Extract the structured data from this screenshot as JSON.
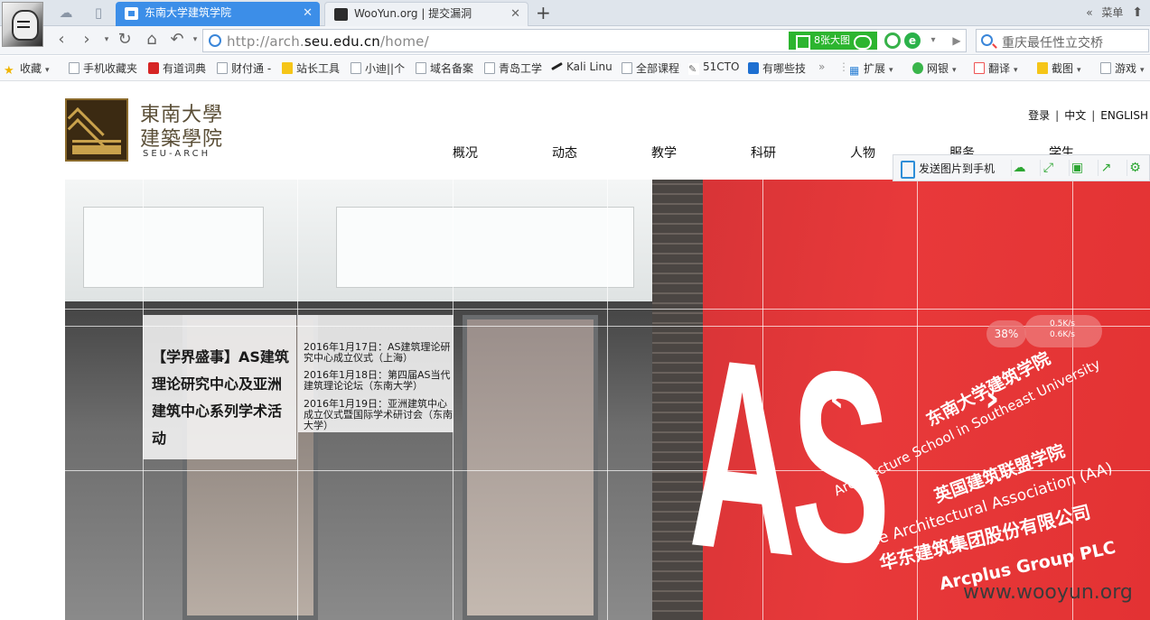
{
  "browser": {
    "tabs": [
      {
        "label": "东南大学建筑学院",
        "active": true
      },
      {
        "label": "WooYun.org | 提交漏洞",
        "active": false
      }
    ],
    "menu_label": "菜单",
    "menu_chevrons": "«",
    "url_prefix": "http://arch.",
    "url_domain": "seu.edu.cn",
    "url_path": "/home/",
    "image_badge": "8张大图",
    "search_placeholder": "重庆最任性立交桥"
  },
  "bookmarks": [
    {
      "label": "收藏",
      "icon": "star-icon"
    },
    {
      "label": "手机收藏夹",
      "icon": "page-icon"
    },
    {
      "label": "有道词典",
      "icon": "youdao-icon"
    },
    {
      "label": "财付通 -",
      "icon": "page-icon"
    },
    {
      "label": "站长工具",
      "icon": "chart-icon"
    },
    {
      "label": "小迪||个",
      "icon": "page-icon"
    },
    {
      "label": "域名备案",
      "icon": "page-icon"
    },
    {
      "label": "青岛工学",
      "icon": "page-icon"
    },
    {
      "label": "Kali Linu",
      "icon": "kali-icon"
    },
    {
      "label": "全部课程",
      "icon": "page-icon"
    },
    {
      "label": "51CTO",
      "icon": "tool-icon"
    },
    {
      "label": "有哪些技",
      "icon": "zhihu-icon"
    },
    {
      "label": "扩展",
      "icon": "apps-icon"
    },
    {
      "label": "网银",
      "icon": "bank-icon"
    },
    {
      "label": "翻译",
      "icon": "translate-icon"
    },
    {
      "label": "截图",
      "icon": "screenshot-icon"
    },
    {
      "label": "游戏",
      "icon": "game-icon"
    }
  ],
  "site": {
    "logo_title_line1": "東南大學",
    "logo_title_line2": "建築學院",
    "logo_en": "SEU-ARCH",
    "lang": {
      "login": "登录",
      "zh": "中文",
      "en": "ENGLISH",
      "sep": "|"
    },
    "nav": [
      "概况",
      "动态",
      "教学",
      "科研",
      "人物",
      "服务",
      "学生"
    ],
    "float_toolbar": {
      "send_label": "发送图片到手机"
    }
  },
  "hero": {
    "event_title": "【学界盛事】AS建筑理论研究中心及亚洲建筑中心系列学术活动",
    "events": [
      "2016年1月17日：AS建筑理论研究中心成立仪式（上海）",
      "2016年1月18日：第四届AS当代建筑理论论坛（东南大学）",
      "2016年1月19日：亚洲建筑中心成立仪式暨国际学术研讨会（东南大学）"
    ],
    "wall_lines": [
      "东南大学建筑学院",
      "Architecture School in Southeast University",
      "英国建筑联盟学院",
      "The Architectural Association (AA)",
      "华东建筑集团股份有限公司",
      "Arcplus Group PLC"
    ],
    "big_letters": "AS",
    "pct": "38%",
    "pct_side_line1": "0.5K/s",
    "pct_side_line2": "0.6K/s"
  },
  "watermark": "www.wooyun.org",
  "colors": {
    "tab_active": "#3c8ee8",
    "wall_red": "#e8393a",
    "badge_green": "#2cb52f"
  }
}
